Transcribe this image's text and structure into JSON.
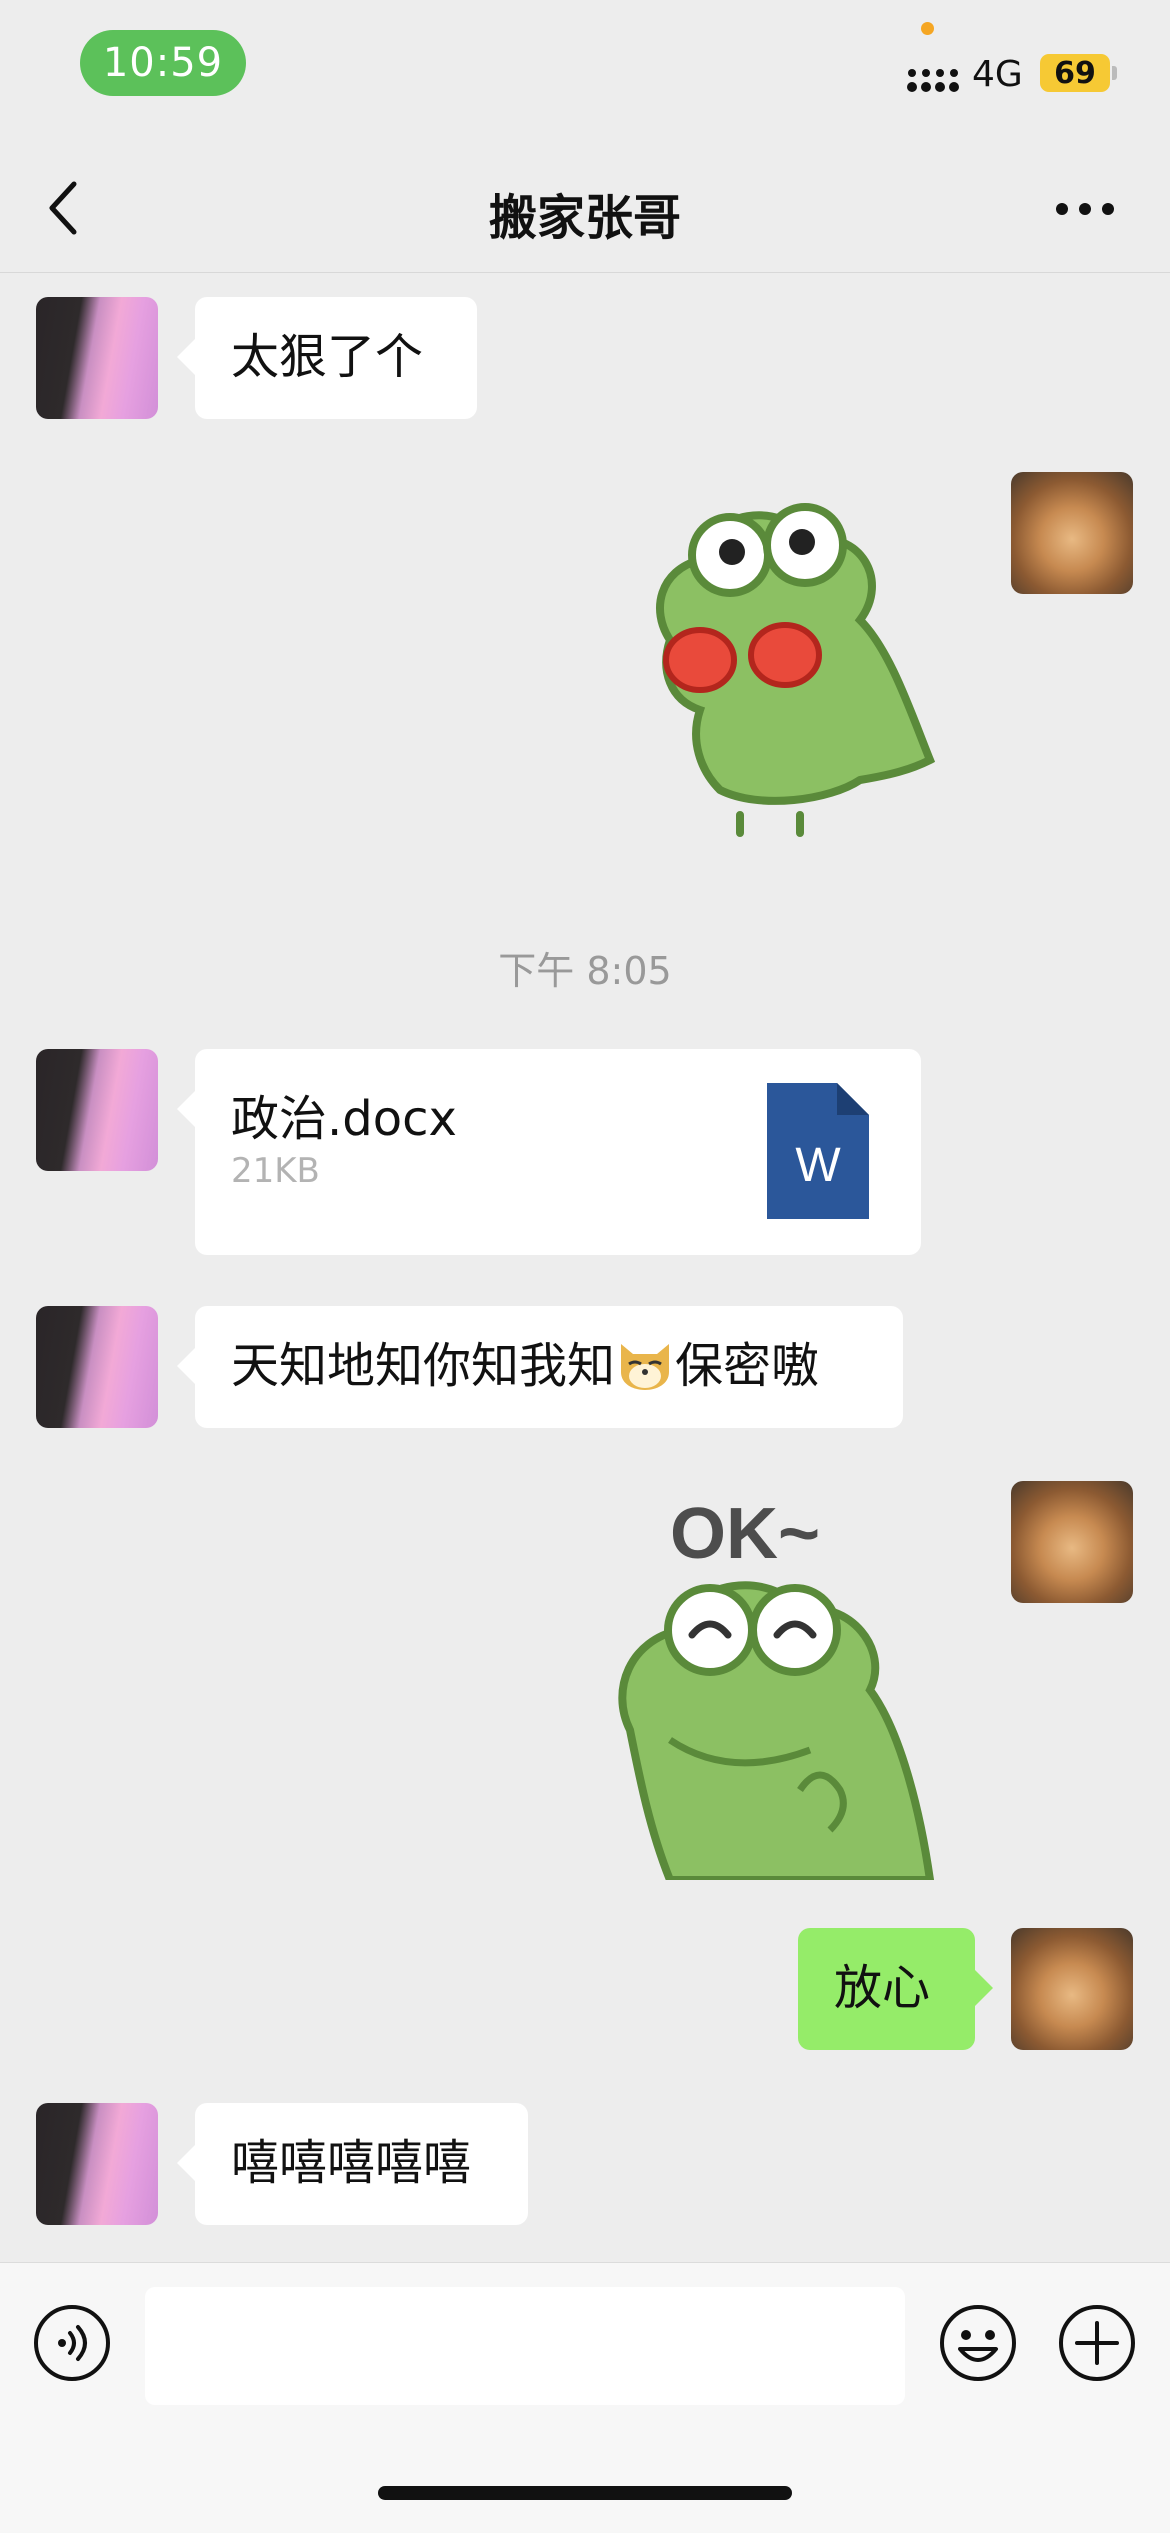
{
  "status_bar": {
    "time": "10:59",
    "network": "4G",
    "battery": "69"
  },
  "nav": {
    "title": "搬家张哥"
  },
  "messages": [
    {
      "side": "them",
      "type": "text",
      "text": "太狠了个"
    },
    {
      "side": "me",
      "type": "sticker",
      "sticker": "crocodile-boxing"
    },
    {
      "type": "timestamp",
      "text": "下午 8:05"
    },
    {
      "side": "them",
      "type": "file",
      "file_name": "政治.docx",
      "file_size": "21KB",
      "file_icon": "W"
    },
    {
      "side": "them",
      "type": "text",
      "text_before": "天知地知你知我知",
      "emoji": "doge-emoji",
      "text_after": "保密嗷"
    },
    {
      "side": "me",
      "type": "sticker",
      "sticker": "crocodile-ok",
      "sticker_text": "OK~"
    },
    {
      "side": "me",
      "type": "text",
      "text": "放心"
    },
    {
      "side": "them",
      "type": "text",
      "text": "嘻嘻嘻嘻嘻"
    }
  ],
  "input_bar": {
    "voice_icon": "voice-icon",
    "emoji_icon": "emoji-icon",
    "plus_icon": "plus-icon"
  },
  "colors": {
    "background": "#ededed",
    "my_bubble": "#95ec69",
    "their_bubble": "#ffffff",
    "time_pill": "#5cc15a",
    "battery": "#f6c934",
    "word_icon": "#2b579a"
  }
}
